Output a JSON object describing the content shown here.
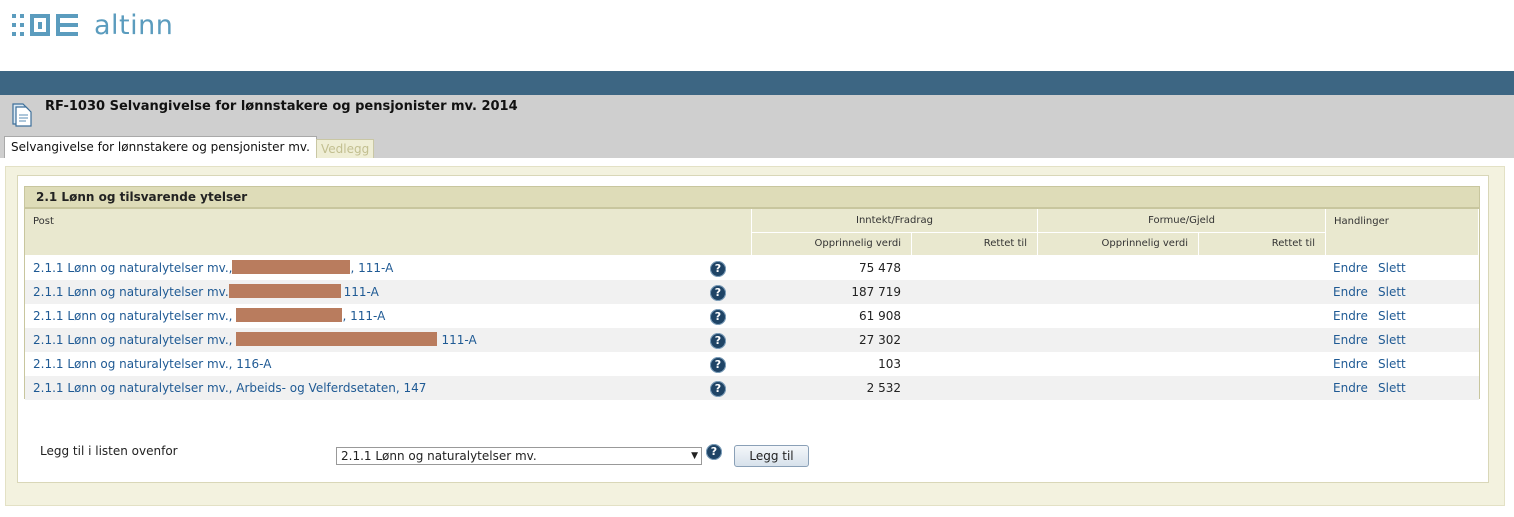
{
  "brand": {
    "name": "altinn",
    "color": "#5b9cbe"
  },
  "form": {
    "title": "RF-1030 Selvangivelse for lønnstakere og pensjonister mv. 2014",
    "tabs": [
      {
        "label": "Selvangivelse for lønnstakere og pensjonister mv.",
        "active": true
      },
      {
        "label": "Vedlegg",
        "active": false
      }
    ]
  },
  "section": {
    "title": "2.1 Lønn og tilsvarende ytelser",
    "headers": {
      "post": "Post",
      "income_group": "Inntekt/Fradrag",
      "wealth_group": "Formue/Gjeld",
      "actions": "Handlinger",
      "original_value": "Opprinnelig verdi",
      "corrected_to": "Rettet til"
    },
    "rows": [
      {
        "prefix": "2.1.1 Lønn og naturalytelser mv.,",
        "suffix": ", 111-A",
        "redacted": true,
        "value": "75 478",
        "edit": "Endre",
        "delete": "Slett"
      },
      {
        "prefix": "2.1.1 Lønn og naturalytelser mv.",
        "suffix": "111-A",
        "redacted": true,
        "value": "187 719",
        "edit": "Endre",
        "delete": "Slett"
      },
      {
        "prefix": "2.1.1 Lønn og naturalytelser mv.,",
        "suffix": ", 111-A",
        "redacted": true,
        "value": "61 908",
        "edit": "Endre",
        "delete": "Slett"
      },
      {
        "prefix": "2.1.1 Lønn og naturalytelser mv.,",
        "suffix": "111-A",
        "redacted": true,
        "value": "27 302",
        "edit": "Endre",
        "delete": "Slett"
      },
      {
        "prefix": "2.1.1 Lønn og naturalytelser mv., 116-A",
        "suffix": "",
        "redacted": false,
        "value": "103",
        "edit": "Endre",
        "delete": "Slett"
      },
      {
        "prefix": "2.1.1 Lønn og naturalytelser mv., Arbeids- og Velferdsetaten, 147",
        "suffix": "",
        "redacted": false,
        "value": "2 532",
        "edit": "Endre",
        "delete": "Slett"
      }
    ],
    "help_glyph": "?"
  },
  "add": {
    "label": "Legg til i listen ovenfor",
    "selected": "2.1.1 Lønn og naturalytelser mv.",
    "button": "Legg til"
  }
}
